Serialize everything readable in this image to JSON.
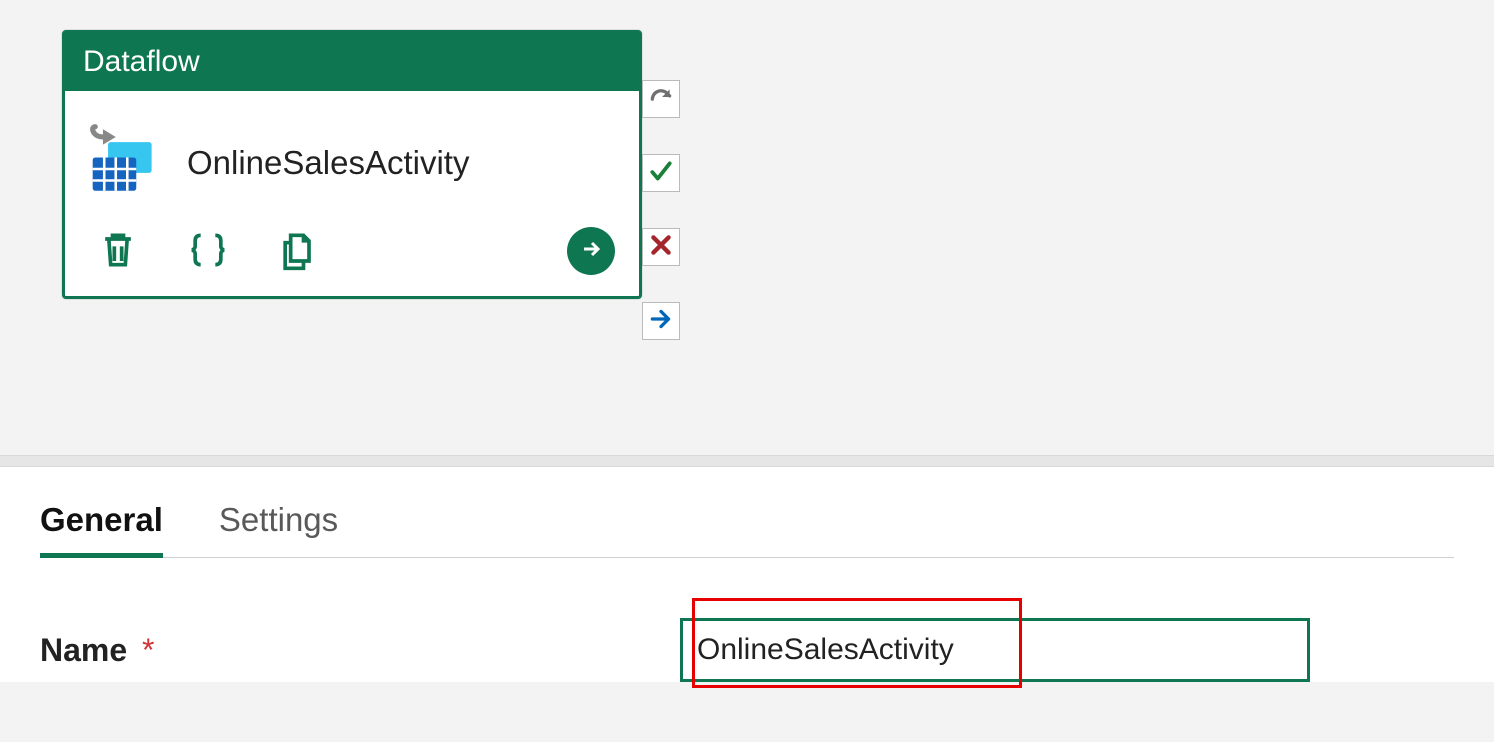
{
  "activity": {
    "type_label": "Dataflow",
    "name": "OnlineSalesActivity"
  },
  "tabs": {
    "general": "General",
    "settings": "Settings"
  },
  "form": {
    "name_label": "Name",
    "required_mark": "*",
    "name_value": "OnlineSalesActivity"
  }
}
